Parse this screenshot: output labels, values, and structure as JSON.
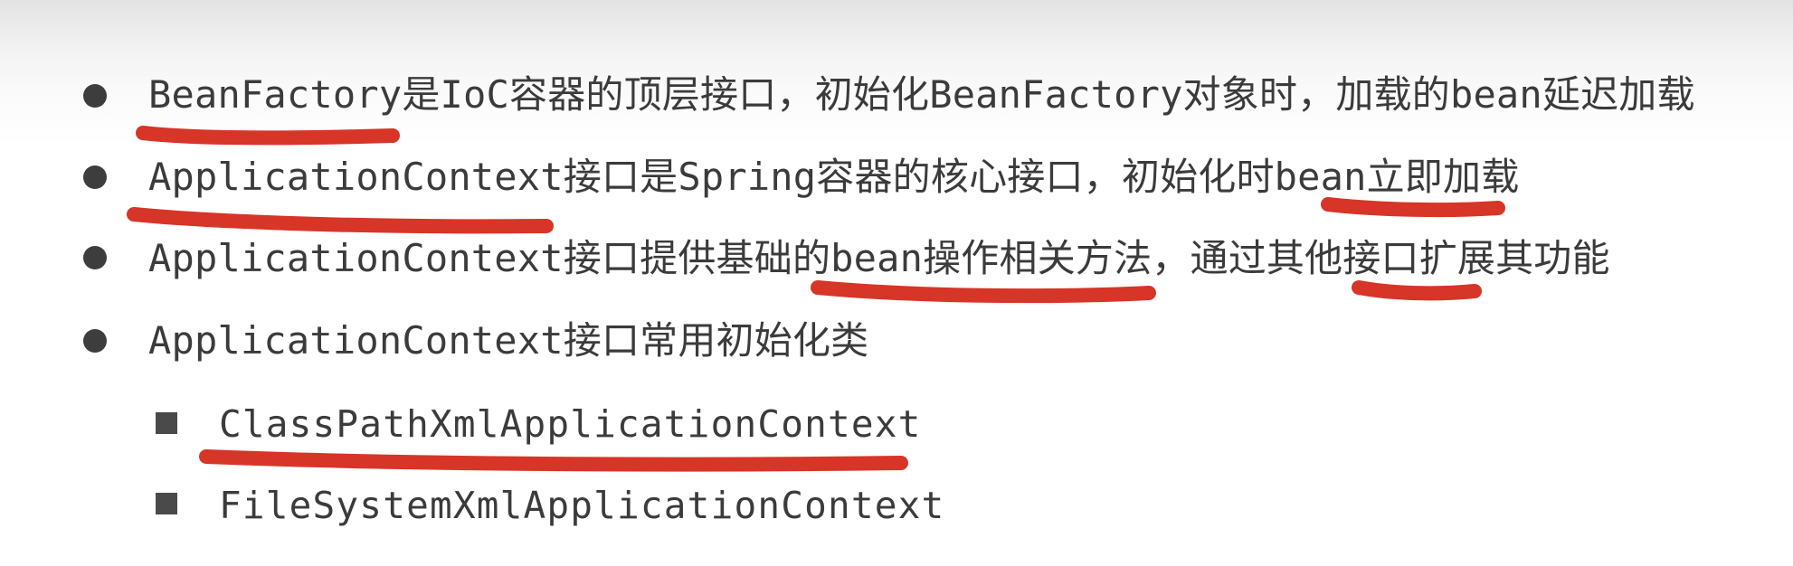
{
  "bullets": [
    {
      "text": "BeanFactory是IoC容器的顶层接口，初始化BeanFactory对象时，加载的bean延迟加载"
    },
    {
      "text": "ApplicationContext接口是Spring容器的核心接口，初始化时bean立即加载"
    },
    {
      "text": "ApplicationContext接口提供基础的bean操作相关方法，通过其他接口扩展其功能"
    },
    {
      "text": "ApplicationContext接口常用初始化类"
    }
  ],
  "sub_bullets": [
    {
      "text": "ClassPathXmlApplicationContext"
    },
    {
      "text": "FileSystemXmlApplicationContext"
    }
  ],
  "colors": {
    "text": "#3b3b3b",
    "bullet": "#3d3d3d",
    "underline": "#d42a1c"
  }
}
